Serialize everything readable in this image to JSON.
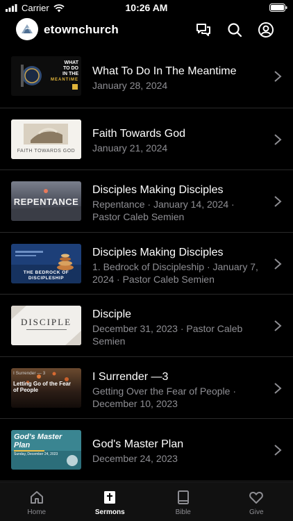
{
  "status_bar": {
    "carrier": "Carrier",
    "time": "10:26 AM"
  },
  "header": {
    "title": "etownchurch"
  },
  "sermons": [
    {
      "title": "What To Do In The Meantime",
      "subtitle": "January 28, 2024",
      "thumb": {
        "lines": [
          "WHAT",
          "TO DO",
          "IN THE",
          "MEANTIME"
        ]
      }
    },
    {
      "title": "Faith Towards God",
      "subtitle": "January 21, 2024",
      "thumb": {
        "lines": [
          "FAITH TOWARDS GOD"
        ]
      }
    },
    {
      "title": "Disciples Making Disciples",
      "subtitle": "Repentance · January 14, 2024 · Pastor Caleb Semien",
      "thumb": {
        "lines": [
          "REPENTANCE"
        ]
      }
    },
    {
      "title": "Disciples Making Disciples",
      "subtitle": "1. Bedrock of Discipleship · January 7, 2024 · Pastor Caleb Semien",
      "thumb": {
        "lines": [
          "THE BEDROCK OF",
          "DISCIPLESHIP"
        ]
      }
    },
    {
      "title": "Disciple",
      "subtitle": "December 31, 2023 · Pastor Caleb Semien",
      "thumb": {
        "lines": [
          "DISCIPLE"
        ]
      }
    },
    {
      "title": "I Surrender —3",
      "subtitle": "Getting Over the Fear of People · December 10, 2023",
      "thumb": {
        "lines": [
          "I Surrender — 3",
          "Letting Go of the Fear",
          "of People"
        ]
      }
    },
    {
      "title": "God's Master Plan",
      "subtitle": "December 24, 2023",
      "thumb": {
        "lines": [
          "God's Master",
          "Plan",
          "Sunday, December 24, 2023"
        ]
      }
    }
  ],
  "tabs": [
    {
      "label": "Home",
      "icon": "home-icon",
      "active": false
    },
    {
      "label": "Sermons",
      "icon": "sermons-icon",
      "active": true
    },
    {
      "label": "Bible",
      "icon": "bible-icon",
      "active": false
    },
    {
      "label": "Give",
      "icon": "heart-icon",
      "active": false
    }
  ],
  "colors": {
    "background": "#000000",
    "secondary_text": "#8e8e93",
    "divider": "#2a2a2a"
  }
}
